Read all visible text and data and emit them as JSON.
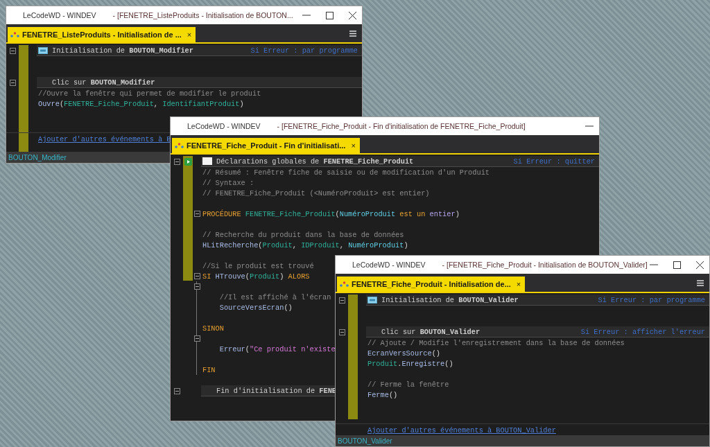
{
  "windows": [
    {
      "app": "LeCodeWD - WINDEV",
      "document": "- [FENETRE_ListeProduits - Initialisation de BOUTON...",
      "minimize": true,
      "maximize": true,
      "close": true,
      "tab": {
        "label": "FENETRE_ListeProduits - Initialisation de ...",
        "close": "×",
        "selected": true
      },
      "menu": true,
      "lines": [
        {
          "kind": "event_header",
          "fold": true,
          "label": "Initialisation de **BOUTON_Modifier**",
          "error": "Si Erreur : par programme"
        },
        {
          "kind": "blank"
        },
        {
          "kind": "blank"
        },
        {
          "kind": "sub_header",
          "fold": true,
          "label": "Clic sur **BOUTON_Modifier**"
        },
        {
          "kind": "code",
          "tokens": [
            {
              "kind": "comment",
              "s": "//Ouvre la fenêtre qui permet de modifier le produit"
            }
          ]
        },
        {
          "kind": "code",
          "tokens": [
            {
              "kind": "func",
              "s": "Ouvre"
            },
            {
              "kind": "plain",
              "s": "("
            },
            {
              "kind": "ident",
              "s": "FENETRE_Fiche_Produit"
            },
            {
              "kind": "plain",
              "s": ", "
            },
            {
              "kind": "ident",
              "s": "IdentifiantProduit"
            },
            {
              "kind": "plain",
              "s": ")"
            }
          ]
        },
        {
          "kind": "blank"
        },
        {
          "kind": "blank"
        }
      ],
      "link": "Ajouter d'autres événements à B",
      "status": "BOUTON_Modifier"
    },
    {
      "app": "LeCodeWD - WINDEV",
      "document": "- [FENETRE_Fiche_Produit - Fin d'initialisation de FENETRE_Fiche_Produit]",
      "minimize": true,
      "tab": {
        "label": "FENETRE_Fiche_Produit - Fin d'initialisati...",
        "close": "×",
        "selected": true
      },
      "lines": [
        {
          "kind": "global_header",
          "marker": true,
          "fold": true,
          "label": "Déclarations globales de **FENETRE_Fiche_Produit**",
          "error": "Si Erreur : quitter"
        },
        {
          "kind": "code",
          "tokens": [
            {
              "kind": "comment",
              "s": "// Résumé : Fenêtre fiche de saisie ou de modification d'un Produit"
            }
          ]
        },
        {
          "kind": "code",
          "tokens": [
            {
              "kind": "comment",
              "s": "// Syntaxe :"
            }
          ]
        },
        {
          "kind": "code",
          "tokens": [
            {
              "kind": "comment",
              "s": "// FENETRE_Fiche_Produit (<NuméroProduit> est entier)"
            }
          ]
        },
        {
          "kind": "blank"
        },
        {
          "kind": "code",
          "fold": true,
          "tokens": [
            {
              "kind": "keyword",
              "s": "PROCÉDURE"
            },
            {
              "kind": "ident",
              "s": " FENETRE_Fiche_Produit"
            },
            {
              "kind": "plain",
              "s": "("
            },
            {
              "kind": "param",
              "s": "NuméroProduit"
            },
            {
              "kind": "keyword",
              "s": " est un"
            },
            {
              "kind": "type",
              "s": " entier"
            },
            {
              "kind": "plain",
              "s": ")"
            }
          ]
        },
        {
          "kind": "blank"
        },
        {
          "kind": "code",
          "tokens": [
            {
              "kind": "comment",
              "s": "// Recherche du produit dans la base de données"
            }
          ]
        },
        {
          "kind": "code",
          "tokens": [
            {
              "kind": "func",
              "s": "HLitRecherche"
            },
            {
              "kind": "plain",
              "s": "("
            },
            {
              "kind": "ident",
              "s": "Produit"
            },
            {
              "kind": "plain",
              "s": ", "
            },
            {
              "kind": "ident",
              "s": "IDProduit"
            },
            {
              "kind": "plain",
              "s": ", "
            },
            {
              "kind": "param",
              "s": "NuméroProduit"
            },
            {
              "kind": "plain",
              "s": ")"
            }
          ]
        },
        {
          "kind": "blank"
        },
        {
          "kind": "code",
          "tokens": [
            {
              "kind": "comment",
              "s": "//Si le produit est trouvé"
            }
          ]
        },
        {
          "kind": "code",
          "fold": true,
          "tokens": [
            {
              "kind": "keyword",
              "s": "SI"
            },
            {
              "kind": "func",
              "s": " HTrouve"
            },
            {
              "kind": "plain",
              "s": "("
            },
            {
              "kind": "ident",
              "s": "Produit"
            },
            {
              "kind": "plain",
              "s": ")"
            },
            {
              "kind": "keyword",
              "s": " ALORS"
            }
          ]
        },
        {
          "kind": "blank",
          "fold": true,
          "guide": true
        },
        {
          "kind": "code",
          "guide": true,
          "tokens": [
            {
              "kind": "comment",
              "s": "    //Il est affiché à l'écran"
            }
          ]
        },
        {
          "kind": "code",
          "guide": true,
          "tokens": [
            {
              "kind": "func",
              "s": "    SourceVersEcran"
            },
            {
              "kind": "plain",
              "s": "()"
            }
          ]
        },
        {
          "kind": "blank",
          "guide": true
        },
        {
          "kind": "code",
          "guide": true,
          "tokens": [
            {
              "kind": "keyword",
              "s": "SINON"
            }
          ]
        },
        {
          "kind": "blank",
          "fold": true,
          "guide": true
        },
        {
          "kind": "code",
          "guide": true,
          "tokens": [
            {
              "kind": "func",
              "s": "    Erreur"
            },
            {
              "kind": "plain",
              "s": "("
            },
            {
              "kind": "string",
              "s": "\"Ce produit n'existe"
            }
          ]
        },
        {
          "kind": "blank",
          "guide": true
        },
        {
          "kind": "code",
          "guide": true,
          "tokens": [
            {
              "kind": "keyword",
              "s": "FIN"
            }
          ]
        },
        {
          "kind": "blank"
        },
        {
          "kind": "sub_header",
          "fold": true,
          "label": "Fin d'initialisation de **FENE**"
        }
      ]
    },
    {
      "app": "LeCodeWD - WINDEV",
      "document": "- [FENETRE_Fiche_Produit - Initialisation de BOUTON_Valider]",
      "minimize": true,
      "maximize": true,
      "close": true,
      "tab": {
        "label": "FENETRE_Fiche_Produit - Initialisation de...",
        "close": "×",
        "selected": true
      },
      "menu": true,
      "lines": [
        {
          "kind": "event_header",
          "fold": true,
          "label": "Initialisation de **BOUTON_Valider**",
          "error": "Si Erreur : par programme"
        },
        {
          "kind": "blank"
        },
        {
          "kind": "blank"
        },
        {
          "kind": "sub_header",
          "fold": true,
          "label": "Clic sur **BOUTON_Valider**",
          "error": "Si Erreur : afficher l'erreur"
        },
        {
          "kind": "code",
          "tokens": [
            {
              "kind": "comment",
              "s": "// Ajoute / Modifie l'enregistrement dans la base de données"
            }
          ]
        },
        {
          "kind": "code",
          "tokens": [
            {
              "kind": "func",
              "s": "EcranVersSource"
            },
            {
              "kind": "plain",
              "s": "()"
            }
          ]
        },
        {
          "kind": "code",
          "tokens": [
            {
              "kind": "ident",
              "s": "Produit"
            },
            {
              "kind": "plain",
              "s": "."
            },
            {
              "kind": "func",
              "s": "Enregistre"
            },
            {
              "kind": "plain",
              "s": "()"
            }
          ]
        },
        {
          "kind": "blank"
        },
        {
          "kind": "code",
          "tokens": [
            {
              "kind": "comment",
              "s": "// Ferme la fenêtre"
            }
          ]
        },
        {
          "kind": "code",
          "tokens": [
            {
              "kind": "func",
              "s": "Ferme"
            },
            {
              "kind": "plain",
              "s": "()"
            }
          ]
        },
        {
          "kind": "blank"
        },
        {
          "kind": "blank"
        }
      ],
      "link": "Ajouter d'autres événements à BOUTON_Valider",
      "status": "BOUTON_Valider"
    }
  ]
}
